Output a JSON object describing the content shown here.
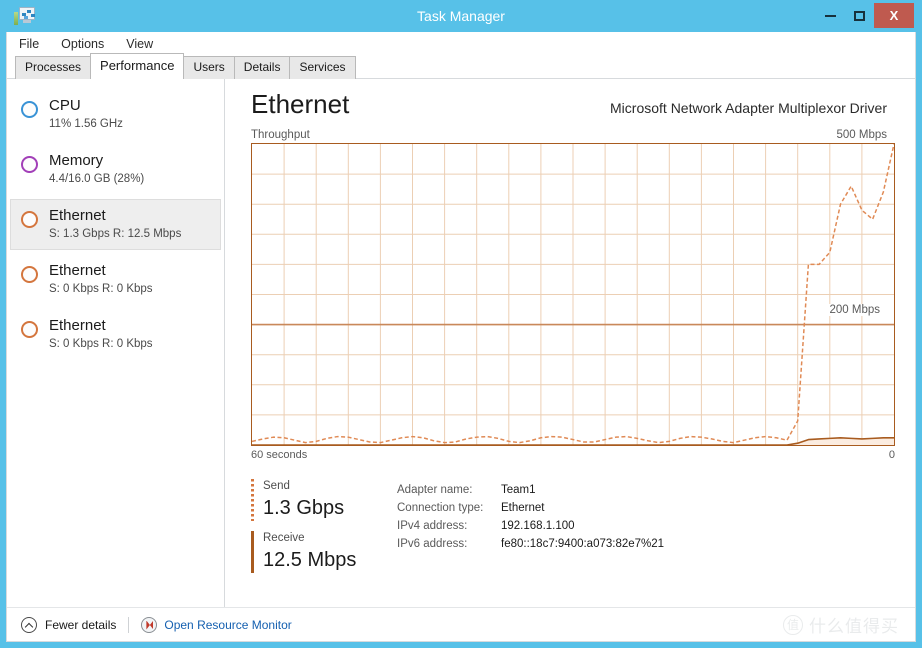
{
  "window": {
    "title": "Task Manager",
    "icon": "task-manager-icon",
    "controls": {
      "minimize": "–",
      "maximize": "□",
      "close": "X"
    }
  },
  "menubar": {
    "items": [
      "File",
      "Options",
      "View"
    ]
  },
  "tabs": [
    {
      "label": "Processes",
      "active": false
    },
    {
      "label": "Performance",
      "active": true
    },
    {
      "label": "Users",
      "active": false
    },
    {
      "label": "Details",
      "active": false
    },
    {
      "label": "Services",
      "active": false
    }
  ],
  "sidebar": {
    "items": [
      {
        "title": "CPU",
        "sub": "11%  1.56 GHz",
        "color": "#3a93d6",
        "selected": false
      },
      {
        "title": "Memory",
        "sub": "4.4/16.0 GB (28%)",
        "color": "#a23fb8",
        "selected": false
      },
      {
        "title": "Ethernet",
        "sub": "S: 1.3 Gbps  R: 12.5 Mbps",
        "color": "#d4763e",
        "selected": true
      },
      {
        "title": "Ethernet",
        "sub": "S: 0 Kbps  R: 0 Kbps",
        "color": "#d4763e",
        "selected": false
      },
      {
        "title": "Ethernet",
        "sub": "S: 0 Kbps  R: 0 Kbps",
        "color": "#d4763e",
        "selected": false
      }
    ]
  },
  "main": {
    "title": "Ethernet",
    "subtitle": "Microsoft Network Adapter Multiplexor Driver",
    "graph_label": "Throughput",
    "graph_max": "500 Mbps",
    "graph_mid": "200 Mbps",
    "axis_left": "60 seconds",
    "axis_right": "0"
  },
  "stats": {
    "send_label": "Send",
    "send_value": "1.3 Gbps",
    "receive_label": "Receive",
    "receive_value": "12.5 Mbps",
    "details": [
      {
        "key": "Adapter name:",
        "value": "Team1"
      },
      {
        "key": "Connection type:",
        "value": "Ethernet"
      },
      {
        "key": "IPv4 address:",
        "value": "192.168.1.100"
      },
      {
        "key": "IPv6 address:",
        "value": "fe80::18c7:9400:a073:82e7%21"
      }
    ]
  },
  "footer": {
    "fewer_details": "Fewer details",
    "resource_monitor": "Open Resource Monitor"
  },
  "watermark": {
    "mark": "值",
    "text": "什么值得买"
  },
  "colors": {
    "titlebar": "#57c1e8",
    "close": "#bf5a4f",
    "graph_border": "#a85b1f",
    "grid": "#eccfb4",
    "send_line": "#e08a55",
    "receive_line": "#a85b1f",
    "receive_fill": "#fbece0",
    "link": "#1560b0"
  },
  "chart_data": {
    "type": "area",
    "title": "Throughput",
    "xlabel": "",
    "ylabel": "Mbps",
    "ylim": [
      0,
      500
    ],
    "xlim": [
      60,
      0
    ],
    "x_tick_labels": [
      "60 seconds",
      "0"
    ],
    "y_annotations": [
      {
        "value": 500,
        "label": "500 Mbps"
      },
      {
        "value": 200,
        "label": "200 Mbps"
      }
    ],
    "grid": {
      "x_divisions": 20,
      "y_divisions": 10,
      "emphasized_y": 200
    },
    "legend": [
      "Send",
      "Receive"
    ],
    "series": [
      {
        "name": "Send",
        "style": "dashed",
        "color": "#e08a55",
        "unit": "Mbps",
        "x": [
          60,
          59,
          58,
          57,
          56,
          55,
          54,
          53,
          52,
          51,
          50,
          49,
          48,
          47,
          46,
          45,
          44,
          43,
          42,
          41,
          40,
          39,
          38,
          37,
          36,
          35,
          34,
          33,
          32,
          31,
          30,
          29,
          28,
          27,
          26,
          25,
          24,
          23,
          22,
          21,
          20,
          19,
          18,
          17,
          16,
          15,
          14,
          13,
          12,
          11,
          10,
          9,
          8,
          7,
          6,
          5,
          4,
          3,
          2,
          1,
          0
        ],
        "values": [
          6,
          10,
          13,
          12,
          8,
          4,
          6,
          11,
          14,
          13,
          9,
          5,
          4,
          8,
          12,
          14,
          12,
          7,
          4,
          5,
          10,
          13,
          14,
          11,
          6,
          4,
          7,
          12,
          14,
          13,
          9,
          5,
          5,
          9,
          13,
          14,
          11,
          7,
          4,
          6,
          11,
          14,
          13,
          10,
          6,
          4,
          8,
          12,
          14,
          12,
          8,
          40,
          300,
          300,
          320,
          400,
          430,
          390,
          375,
          420,
          500
        ]
      },
      {
        "name": "Receive",
        "style": "solid",
        "color": "#a85b1f",
        "unit": "Mbps",
        "x": [
          60,
          59,
          58,
          57,
          56,
          55,
          54,
          53,
          52,
          51,
          50,
          49,
          48,
          47,
          46,
          45,
          44,
          43,
          42,
          41,
          40,
          39,
          38,
          37,
          36,
          35,
          34,
          33,
          32,
          31,
          30,
          29,
          28,
          27,
          26,
          25,
          24,
          23,
          22,
          21,
          20,
          19,
          18,
          17,
          16,
          15,
          14,
          13,
          12,
          11,
          10,
          9,
          8,
          7,
          6,
          5,
          4,
          3,
          2,
          1,
          0
        ],
        "values": [
          0,
          0,
          0,
          0,
          0,
          0,
          0,
          0,
          0,
          0,
          0,
          0,
          0,
          0,
          0,
          0,
          0,
          0,
          0,
          0,
          0,
          0,
          0,
          0,
          0,
          0,
          0,
          0,
          0,
          0,
          0,
          0,
          0,
          0,
          0,
          0,
          0,
          0,
          0,
          0,
          0,
          0,
          0,
          0,
          0,
          0,
          0,
          0,
          0,
          0,
          0,
          3,
          9,
          10,
          11,
          12,
          11,
          10,
          11,
          12,
          12
        ]
      }
    ]
  }
}
